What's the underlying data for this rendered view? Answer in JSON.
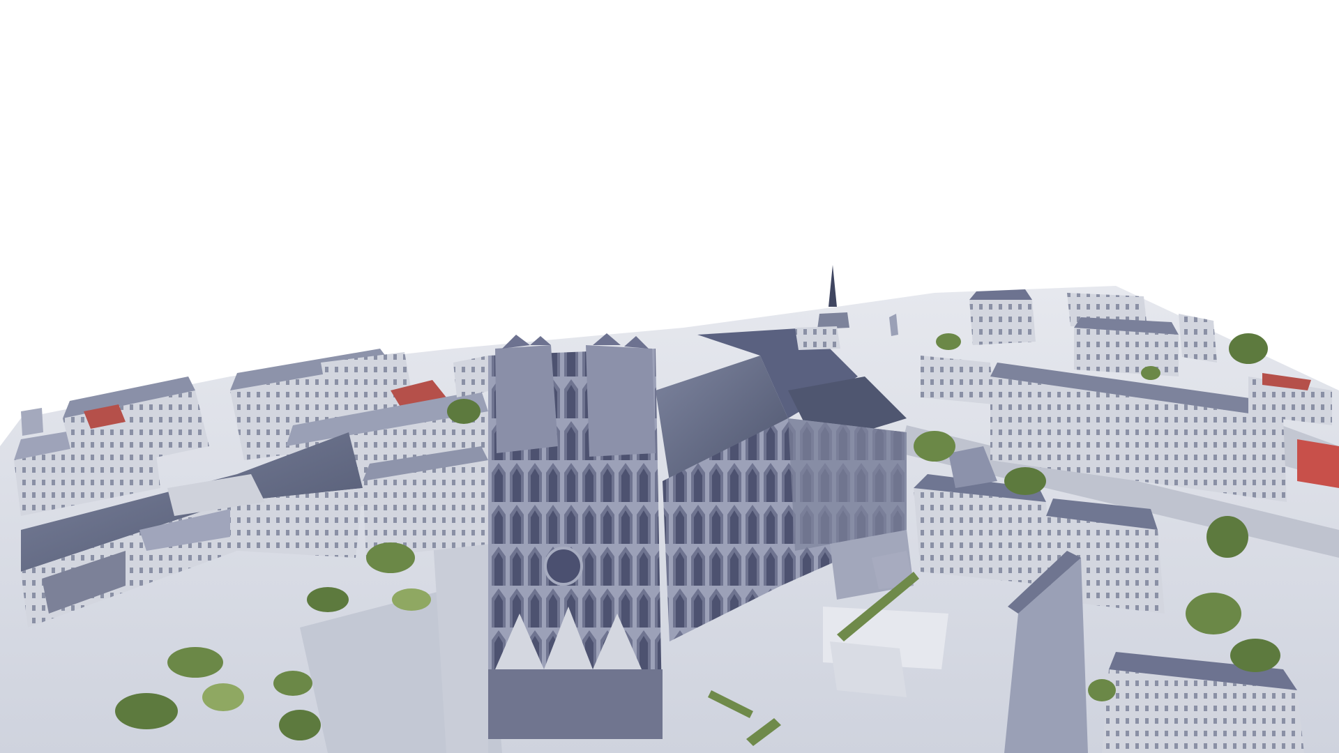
{
  "view": {
    "sky_color": "#ffffff",
    "ground_color": "#d9dce4",
    "roof_color": "#5d6580",
    "roof_light_color": "#8d95ad",
    "stone_color": "#c9ccd6",
    "stone_shadow_color": "#8e93a6",
    "facade_color": "#b6b9c8",
    "tree_color": "#5d7a3e",
    "tree_light_color": "#8fa862",
    "road_color": "#b9bdc9",
    "brick_color": "#b5504a"
  }
}
